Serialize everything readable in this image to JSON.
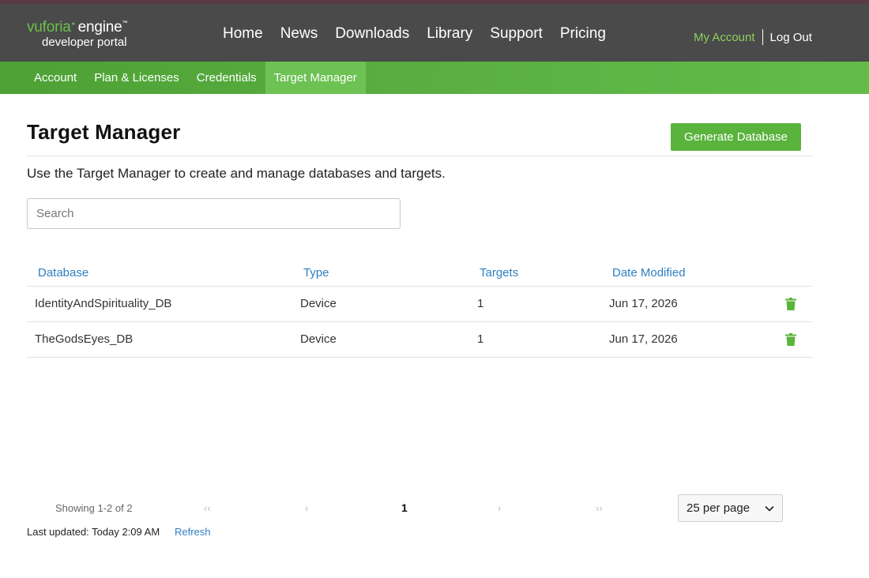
{
  "header": {
    "logo": {
      "brand": "vuforia",
      "product": "engine",
      "subtitle": "developer portal"
    },
    "nav": [
      "Home",
      "News",
      "Downloads",
      "Library",
      "Support",
      "Pricing"
    ],
    "my_account": "My Account",
    "log_out": "Log Out"
  },
  "subnav": {
    "items": [
      "Account",
      "Plan & Licenses",
      "Credentials",
      "Target Manager"
    ],
    "active": "Target Manager"
  },
  "main": {
    "title": "Target Manager",
    "generate_button": "Generate Database",
    "intro": "Use the Target Manager to create and manage databases and targets.",
    "search_placeholder": "Search"
  },
  "table": {
    "columns": [
      "Database",
      "Type",
      "Targets",
      "Date Modified"
    ],
    "rows": [
      {
        "database": "IdentityAndSpirituality_DB",
        "type": "Device",
        "targets": "1",
        "date": "Jun 17, 2026",
        "action": "trash-icon"
      },
      {
        "database": "TheGodsEyes_DB",
        "type": "Device",
        "targets": "1",
        "date": "Jun 17, 2026",
        "action": "trash-icon"
      }
    ]
  },
  "pagination": {
    "showing": "Showing 1-2 of 2",
    "first": "‹‹",
    "prev": "‹",
    "current": "1",
    "next": "›",
    "last": "››",
    "per_page": "25 per page"
  },
  "footer": {
    "last_updated": "Last updated: Today 2:09 AM",
    "refresh": "Refresh"
  },
  "colors": {
    "brand_green": "#5ab33d",
    "link_blue": "#2d7fc1",
    "header_bg": "#4a4a4a"
  }
}
